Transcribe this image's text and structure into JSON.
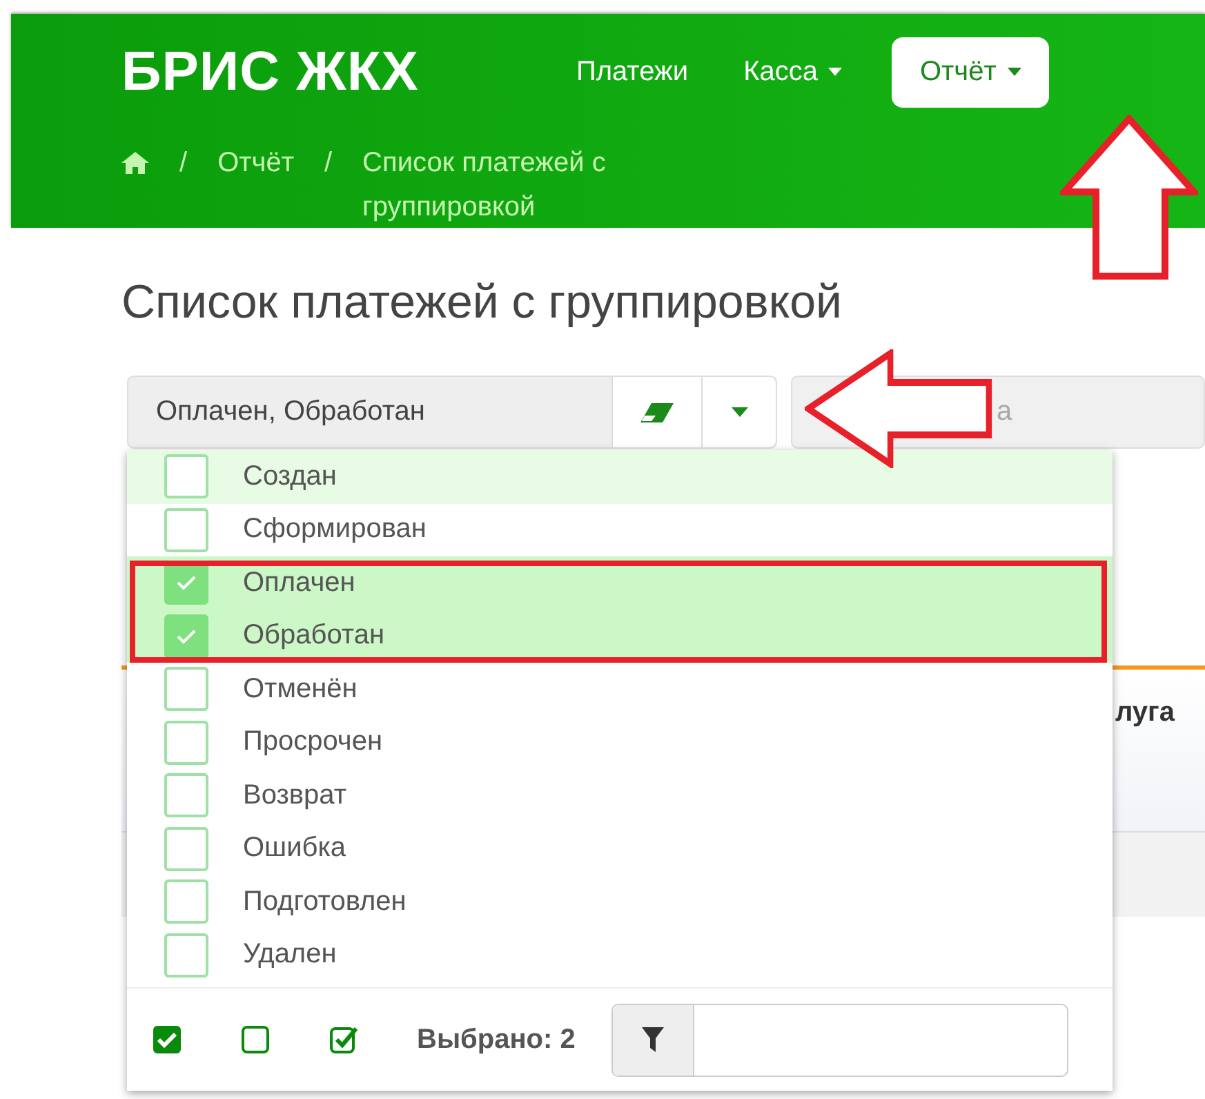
{
  "header": {
    "brand": "БРИС ЖКХ",
    "nav": [
      {
        "label": "Платежи",
        "has_caret": false,
        "selected": false
      },
      {
        "label": "Касса",
        "has_caret": true,
        "selected": false
      },
      {
        "label": "Отчёт",
        "has_caret": true,
        "selected": true
      }
    ],
    "breadcrumb": [
      {
        "separator": "/",
        "label": "Отчёт"
      },
      {
        "separator": "/",
        "label": "Список платежей с группировкой"
      }
    ]
  },
  "title": "Список платежей с группировкой",
  "status_select": {
    "value": "Оплачен, Обработан",
    "expanded": true,
    "options": [
      {
        "label": "Создан",
        "checked": false,
        "hovered": true
      },
      {
        "label": "Сформирован",
        "checked": false,
        "hovered": false
      },
      {
        "label": "Оплачен",
        "checked": true,
        "hovered": false
      },
      {
        "label": "Обработан",
        "checked": true,
        "hovered": false
      },
      {
        "label": "Отменён",
        "checked": false,
        "hovered": false
      },
      {
        "label": "Просрочен",
        "checked": false,
        "hovered": false
      },
      {
        "label": "Возврат",
        "checked": false,
        "hovered": false
      },
      {
        "label": "Ошибка",
        "checked": false,
        "hovered": false
      },
      {
        "label": "Подготовлен",
        "checked": false,
        "hovered": false
      },
      {
        "label": "Удален",
        "checked": false,
        "hovered": false
      }
    ],
    "selected_count": "Выбрано: 2"
  },
  "second_field": {
    "placeholder": "а"
  },
  "table": {
    "column_fragment": "луга"
  }
}
